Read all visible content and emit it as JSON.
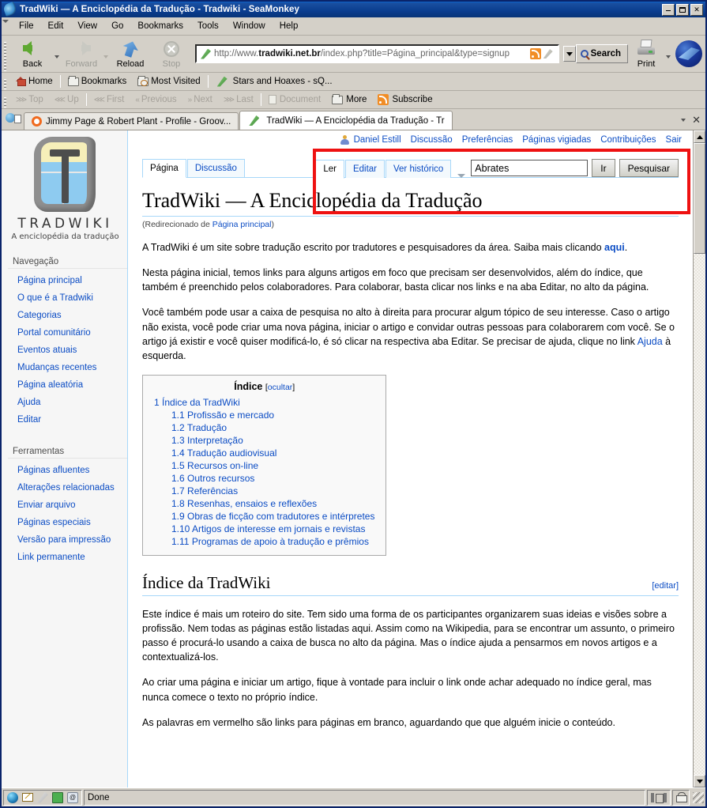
{
  "window": {
    "title": "TradWiki — A Enciclopédia da Tradução - Tradwiki - SeaMonkey",
    "icon": "seamonkey-feather-icon",
    "minimize_label": "_",
    "maximize_label": "□",
    "close_label": "✕"
  },
  "menubar": {
    "items": [
      {
        "label": "File"
      },
      {
        "label": "Edit"
      },
      {
        "label": "View"
      },
      {
        "label": "Go"
      },
      {
        "label": "Bookmarks"
      },
      {
        "label": "Tools"
      },
      {
        "label": "Window"
      },
      {
        "label": "Help"
      }
    ]
  },
  "navtoolbar": {
    "back_label": "Back",
    "forward_label": "Forward",
    "reload_label": "Reload",
    "stop_label": "Stop",
    "print_label": "Print",
    "search_label": "Search",
    "url_prefix": "http://www.",
    "url_domain": "tradwiki.net.br",
    "url_suffix": "/index.php?title=Página_principal&type=signup",
    "url_full": "http://www.tradwiki.net.br/index.php?title=Página_principal&type=signup"
  },
  "bookmarkbar": {
    "items": [
      {
        "label": "Home",
        "icon": "home-icon"
      },
      {
        "label": "Bookmarks",
        "icon": "folder-icon"
      },
      {
        "label": "Most Visited",
        "icon": "folder-clock-icon"
      },
      {
        "label": "Stars and Hoaxes - sQ...",
        "icon": "feather-icon"
      }
    ]
  },
  "sitenavbar": {
    "items": [
      {
        "label": "Top",
        "enabled": false
      },
      {
        "label": "Up",
        "enabled": false
      },
      {
        "label": "First",
        "enabled": false
      },
      {
        "label": "Previous",
        "enabled": false
      },
      {
        "label": "Next",
        "enabled": false
      },
      {
        "label": "Last",
        "enabled": false
      },
      {
        "label": "Document",
        "enabled": false
      },
      {
        "label": "More",
        "enabled": true
      },
      {
        "label": "Subscribe",
        "enabled": true
      }
    ]
  },
  "tabbar": {
    "tabs": [
      {
        "label": "Jimmy Page & Robert Plant - Profile - Groov...",
        "icon": "groovy-icon",
        "active": false
      },
      {
        "label": "TradWiki — A Enciclopédia da Tradução - Tr",
        "icon": "feather-icon",
        "active": true
      }
    ],
    "close_label": "✕"
  },
  "wiki": {
    "logo": {
      "wordmark": "TRADWIKI",
      "tagline": "A enciclopédia da tradução"
    },
    "sidebar": {
      "nav_heading": "Navegação",
      "nav_items": [
        {
          "label": "Página principal"
        },
        {
          "label": "O que é a Tradwiki"
        },
        {
          "label": "Categorias"
        },
        {
          "label": "Portal comunitário"
        },
        {
          "label": "Eventos atuais"
        },
        {
          "label": "Mudanças recentes"
        },
        {
          "label": "Página aleatória"
        },
        {
          "label": "Ajuda"
        },
        {
          "label": "Editar"
        }
      ],
      "tools_heading": "Ferramentas",
      "tools_items": [
        {
          "label": "Páginas afluentes"
        },
        {
          "label": "Alterações relacionadas"
        },
        {
          "label": "Enviar arquivo"
        },
        {
          "label": "Páginas especiais"
        },
        {
          "label": "Versão para impressão"
        },
        {
          "label": "Link permanente"
        }
      ]
    },
    "user_links": {
      "username": "Daniel Estill",
      "items": [
        {
          "label": "Discussão"
        },
        {
          "label": "Preferências"
        },
        {
          "label": "Páginas vigiadas"
        },
        {
          "label": "Contribuições"
        },
        {
          "label": "Sair"
        }
      ]
    },
    "page_tabs": [
      {
        "label": "Página",
        "selected": true
      },
      {
        "label": "Discussão",
        "selected": false
      }
    ],
    "action_tabs": [
      {
        "label": "Ler",
        "selected": true
      },
      {
        "label": "Editar",
        "selected": false
      },
      {
        "label": "Ver histórico",
        "selected": false
      }
    ],
    "search": {
      "value": "Abrates",
      "go_label": "Ir",
      "search_label": "Pesquisar"
    },
    "title": "TradWiki — A Enciclopédia da Tradução",
    "redirect_prefix": "(Redirecionado de ",
    "redirect_link": "Página principal",
    "redirect_suffix": ")",
    "paragraphs": {
      "p1_before": "A TradWiki é um site sobre tradução escrito por tradutores e pesquisadores da área. Saiba mais clicando ",
      "p1_link": "aqui",
      "p1_after": ".",
      "p2": "Nesta página inicial, temos links para alguns artigos em foco que precisam ser desenvolvidos, além do índice, que também é preenchido pelos colaboradores. Para colaborar, basta clicar nos links e na aba Editar, no alto da página.",
      "p3_before": "Você também pode usar a caixa de pesquisa no alto à direita para procurar algum tópico de seu interesse. Caso o artigo não exista, você pode criar uma nova página, iniciar o artigo e convidar outras pessoas para colaborarem com você. Se o artigo já existir e você quiser modificá-lo, é só clicar na respectiva aba Editar. Se precisar de ajuda, clique no link ",
      "p3_link": "Ajuda",
      "p3_after": " à esquerda."
    },
    "toc": {
      "title": "Índice",
      "toggle_open": "[",
      "toggle_label": "ocultar",
      "toggle_close": "]",
      "entries": [
        {
          "num": "1",
          "label": "Índice da TradWiki",
          "level": 1
        },
        {
          "num": "1.1",
          "label": "Profissão e mercado",
          "level": 2
        },
        {
          "num": "1.2",
          "label": "Tradução",
          "level": 2
        },
        {
          "num": "1.3",
          "label": "Interpretação",
          "level": 2
        },
        {
          "num": "1.4",
          "label": "Tradução audiovisual",
          "level": 2
        },
        {
          "num": "1.5",
          "label": "Recursos on-line",
          "level": 2
        },
        {
          "num": "1.6",
          "label": "Outros recursos",
          "level": 2
        },
        {
          "num": "1.7",
          "label": "Referências",
          "level": 2
        },
        {
          "num": "1.8",
          "label": "Resenhas, ensaios e reflexões",
          "level": 2
        },
        {
          "num": "1.9",
          "label": "Obras de ficção com tradutores e intérpretes",
          "level": 2
        },
        {
          "num": "1.10",
          "label": "Artigos de interesse em jornais e revistas",
          "level": 2
        },
        {
          "num": "1.11",
          "label": "Programas de apoio à tradução e prêmios",
          "level": 2
        }
      ]
    },
    "section": {
      "heading": "Índice da TradWiki",
      "edit_open": "[",
      "edit_label": "editar",
      "edit_close": "]",
      "p1": "Este índice é mais um roteiro do site. Tem sido uma forma de os participantes organizarem suas ideias e visões sobre a profissão. Nem todas as páginas estão listadas aqui. Assim como na Wikipedia, para se encontrar um assunto, o primeiro passo é procurá-lo usando a caixa de busca no alto da página. Mas o índice ajuda a pensarmos em novos artigos e a contextualizá-los.",
      "p2": "Ao criar uma página e iniciar um artigo, fique à vontade para incluir o link onde achar adequado no índice geral, mas nunca comece o texto no próprio índice.",
      "p3": "As palavras em vermelho são links para páginas em branco, aguardando que que alguém inicie o conteúdo."
    }
  },
  "statusbar": {
    "status_text": "Done",
    "icons": [
      "browser-icon",
      "mail-icon",
      "compose-icon",
      "addressbook-icon",
      "irc-icon",
      "sync-icon",
      "lock-icon"
    ]
  },
  "colors": {
    "highlight_box": "#ee1111",
    "link": "#0b4cc4",
    "titlebar": "#0a3d8f",
    "chrome": "#d4d0c8"
  }
}
